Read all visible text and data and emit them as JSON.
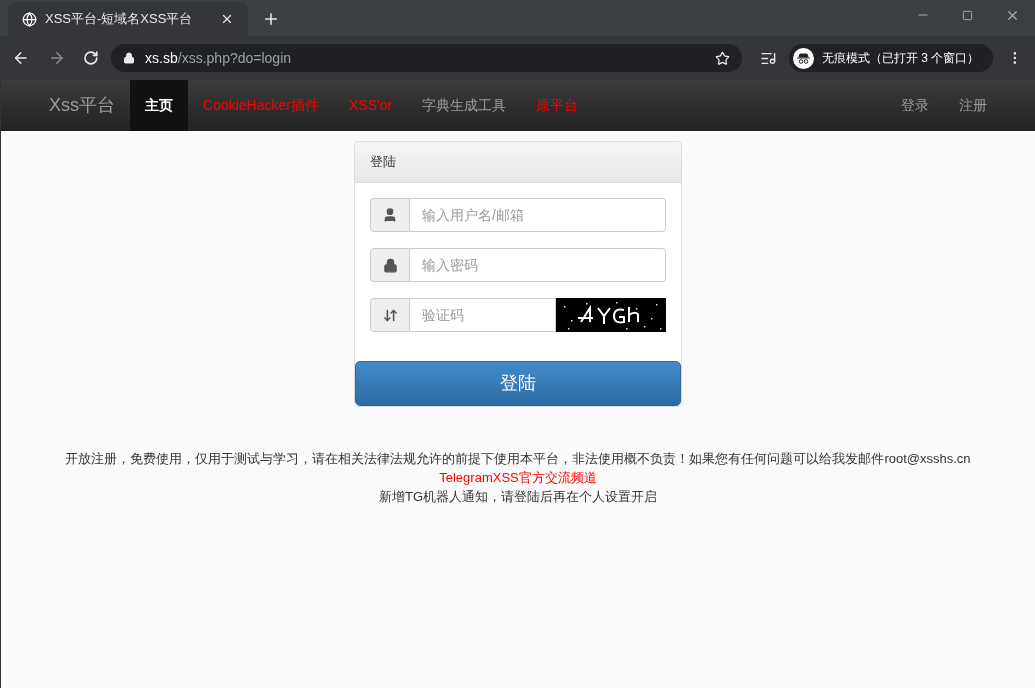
{
  "browser": {
    "tab": {
      "title": "XSS平台-短域名XSS平台"
    },
    "url": {
      "host": "xs.sb",
      "path": "/xss.php?do=login"
    },
    "incognito": {
      "label": "无痕模式（已打开 3 个窗口）"
    }
  },
  "navbar": {
    "brand": "Xss平台",
    "items": [
      {
        "label": "主页",
        "selected": true,
        "kind": "plain"
      },
      {
        "label": "CookieHacker插件",
        "selected": false,
        "kind": "hot"
      },
      {
        "label": "XSS'or",
        "selected": false,
        "kind": "hot"
      },
      {
        "label": "字典生成工具",
        "selected": false,
        "kind": "plain"
      },
      {
        "label": "原平台",
        "selected": false,
        "kind": "hot"
      }
    ],
    "right_items": [
      "登录",
      "注册"
    ]
  },
  "login": {
    "title": "登陆",
    "fields": [
      {
        "kind": "user",
        "placeholder": "输入用户名/邮箱"
      },
      {
        "kind": "password",
        "placeholder": "输入密码"
      },
      {
        "kind": "captcha",
        "placeholder": "验证码"
      }
    ],
    "submit": "登陆"
  },
  "footer": {
    "notice": "开放注册，免费使用，仅用于测试与学习，请在相关法律法规允许的前提下使用本平台，非法使用概不负责！如果您有任何问题可以给我发邮件root@xsshs.cn",
    "link": "TelegramXSS官方交流频道",
    "note": "新增TG机器人通知，请登陆后再在个人设置开启"
  }
}
